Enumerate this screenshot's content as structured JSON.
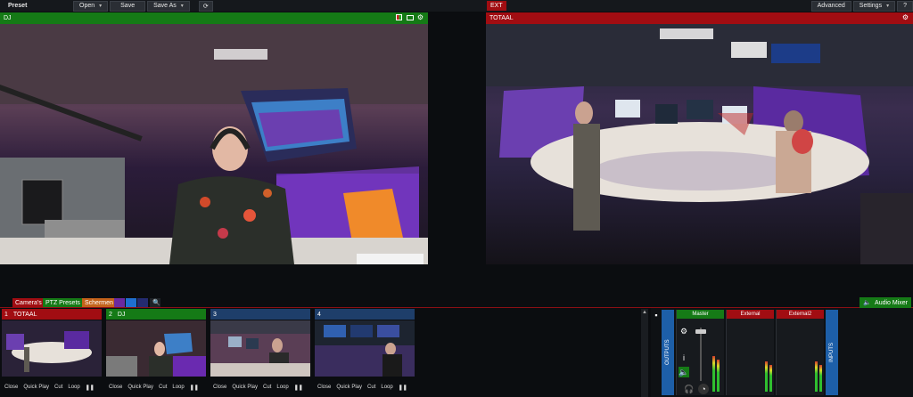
{
  "toolbar": {
    "section_label": "Preset",
    "open_label": "Open",
    "save_label": "Save",
    "saveas_label": "Save As",
    "ext_label": "EXT",
    "advanced_label": "Advanced",
    "settings_label": "Settings",
    "help_label": "?"
  },
  "preview": {
    "label": "DJ",
    "color": "#157a16"
  },
  "output": {
    "label": "TOTAAL",
    "color": "#a10d12"
  },
  "tabs": [
    {
      "label": "Camera's",
      "color": "#a10d12"
    },
    {
      "label": "PTZ Presets",
      "color": "#157a16"
    },
    {
      "label": "Schermen",
      "color": "#c4621a"
    }
  ],
  "audio_mixer_label": "Audio Mixer",
  "inputs": [
    {
      "number": "1",
      "name": "TOTAAL",
      "color": "#a10d12"
    },
    {
      "number": "2",
      "name": "DJ",
      "color": "#157a16"
    },
    {
      "number": "3",
      "name": "",
      "color": "#1e3e6a"
    },
    {
      "number": "4",
      "name": "",
      "color": "#1e3e6a"
    }
  ],
  "input_controls": {
    "close": "Close",
    "quick_play": "Quick Play",
    "cut": "Cut",
    "loop": "Loop"
  },
  "mixer": {
    "outputs_label": "OUTPUTS",
    "inputs_label": "INPUTS",
    "master_label": "Master",
    "external_label": "External",
    "external2_label": "External2"
  }
}
